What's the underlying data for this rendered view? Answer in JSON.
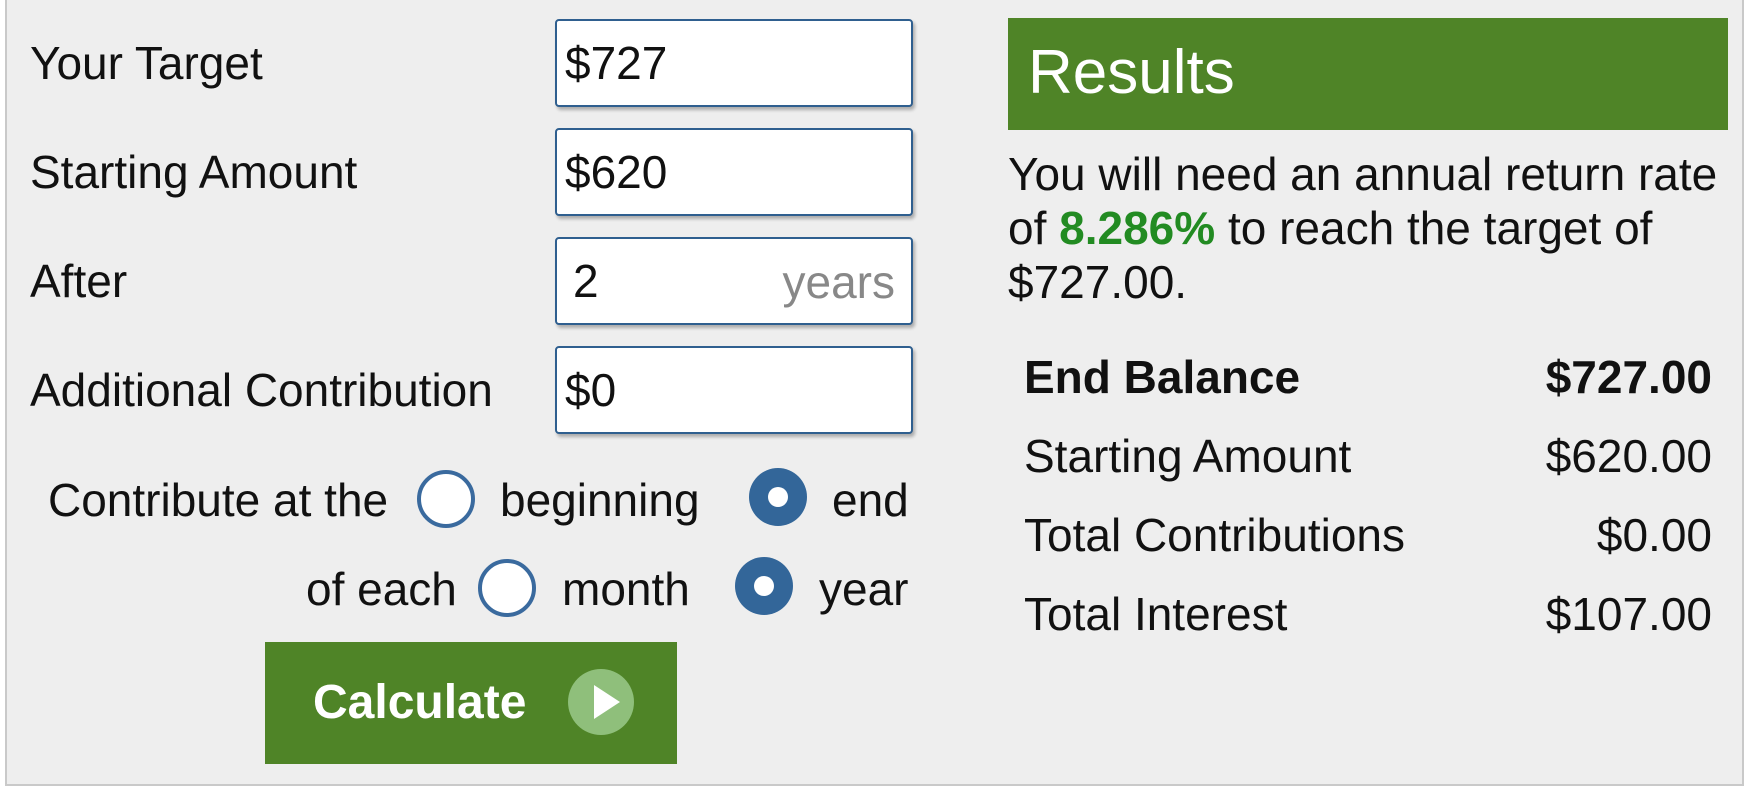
{
  "form": {
    "target_label": "Your Target",
    "target_value": "$727",
    "starting_label": "Starting Amount",
    "starting_value": "$620",
    "after_label": "After",
    "after_value": "2",
    "after_unit": "years",
    "contribution_label": "Additional Contribution",
    "contribution_value": "$0",
    "contribute_at_label": "Contribute at the",
    "beginning_label": "beginning",
    "end_label": "end",
    "of_each_label": "of each",
    "month_label": "month",
    "year_label": "year",
    "timing_selected": "end",
    "period_selected": "year",
    "calculate_label": "Calculate"
  },
  "results": {
    "title": "Results",
    "summary_prefix": "You will need an annual return rate of ",
    "rate": "8.286%",
    "summary_suffix": " to reach the target of $727.00.",
    "rows": [
      {
        "label": "End Balance",
        "value": "$727.00",
        "bold": true
      },
      {
        "label": "Starting Amount",
        "value": "$620.00",
        "bold": false
      },
      {
        "label": "Total Contributions",
        "value": "$0.00",
        "bold": false
      },
      {
        "label": "Total Interest",
        "value": "$107.00",
        "bold": false
      }
    ]
  },
  "colors": {
    "accent_green": "#4f8427",
    "rate_green": "#228B22",
    "radio_blue": "#336699",
    "panel_bg": "#eeeeee"
  }
}
